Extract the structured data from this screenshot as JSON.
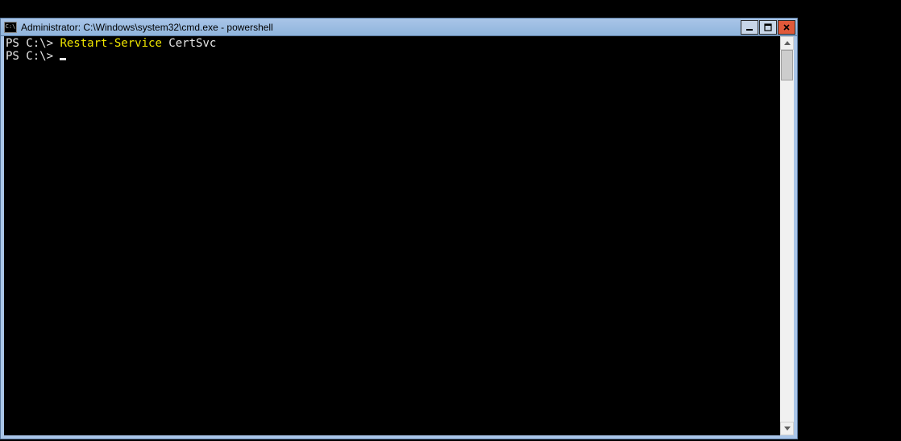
{
  "window": {
    "title": "Administrator: C:\\Windows\\system32\\cmd.exe - powershell",
    "icon_label": "C:\\"
  },
  "terminal": {
    "lines": [
      {
        "prompt": "PS C:\\> ",
        "cmd": "Restart-Service",
        "arg": " CertSvc"
      },
      {
        "prompt": "PS C:\\> ",
        "cursor": true
      }
    ]
  }
}
